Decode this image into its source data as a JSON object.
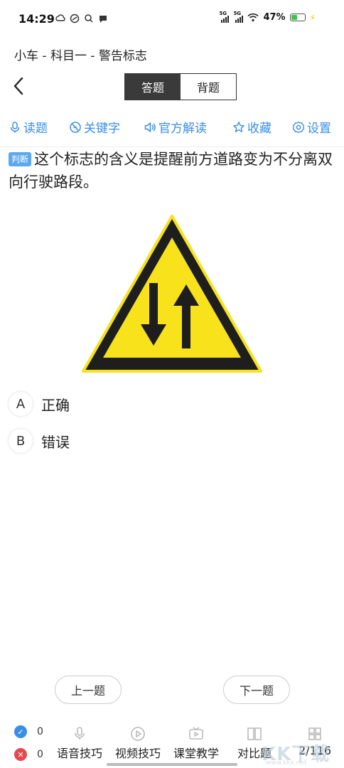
{
  "status_bar": {
    "time": "14:29",
    "signal1_label": "5G",
    "signal2_label": "5G",
    "battery": "47%"
  },
  "breadcrumb": "小车 - 科目一 - 警告标志",
  "mode_tabs": [
    {
      "label": "答题",
      "active": true
    },
    {
      "label": "背题",
      "active": false
    }
  ],
  "toolbar": [
    {
      "label": "读题",
      "icon": "microphone-icon"
    },
    {
      "label": "关键字",
      "icon": "key-icon"
    },
    {
      "label": "官方解读",
      "icon": "speaker-icon"
    },
    {
      "label": "收藏",
      "icon": "star-icon"
    },
    {
      "label": "设置",
      "icon": "gear-icon"
    }
  ],
  "question": {
    "type_badge": "判断",
    "text": "这个标志的含义是提醒前方道路变为不分离双向行驶路段。"
  },
  "options": [
    {
      "letter": "A",
      "text": "正确"
    },
    {
      "letter": "B",
      "text": "错误"
    }
  ],
  "nav": {
    "prev": "上一题",
    "next": "下一题"
  },
  "bottom_bar": {
    "correct_count": "0",
    "wrong_count": "0",
    "items": [
      "语音技巧",
      "视频技巧",
      "课堂教学",
      "对比题"
    ],
    "progress": "2/116"
  },
  "watermark": {
    "text": "KK下载",
    "url": "www.kkx.net"
  },
  "colors": {
    "accent": "#3a8ee6",
    "badge": "#5aa9f0",
    "sign_yellow": "#f7e21b",
    "sign_black": "#1e1e1e"
  }
}
